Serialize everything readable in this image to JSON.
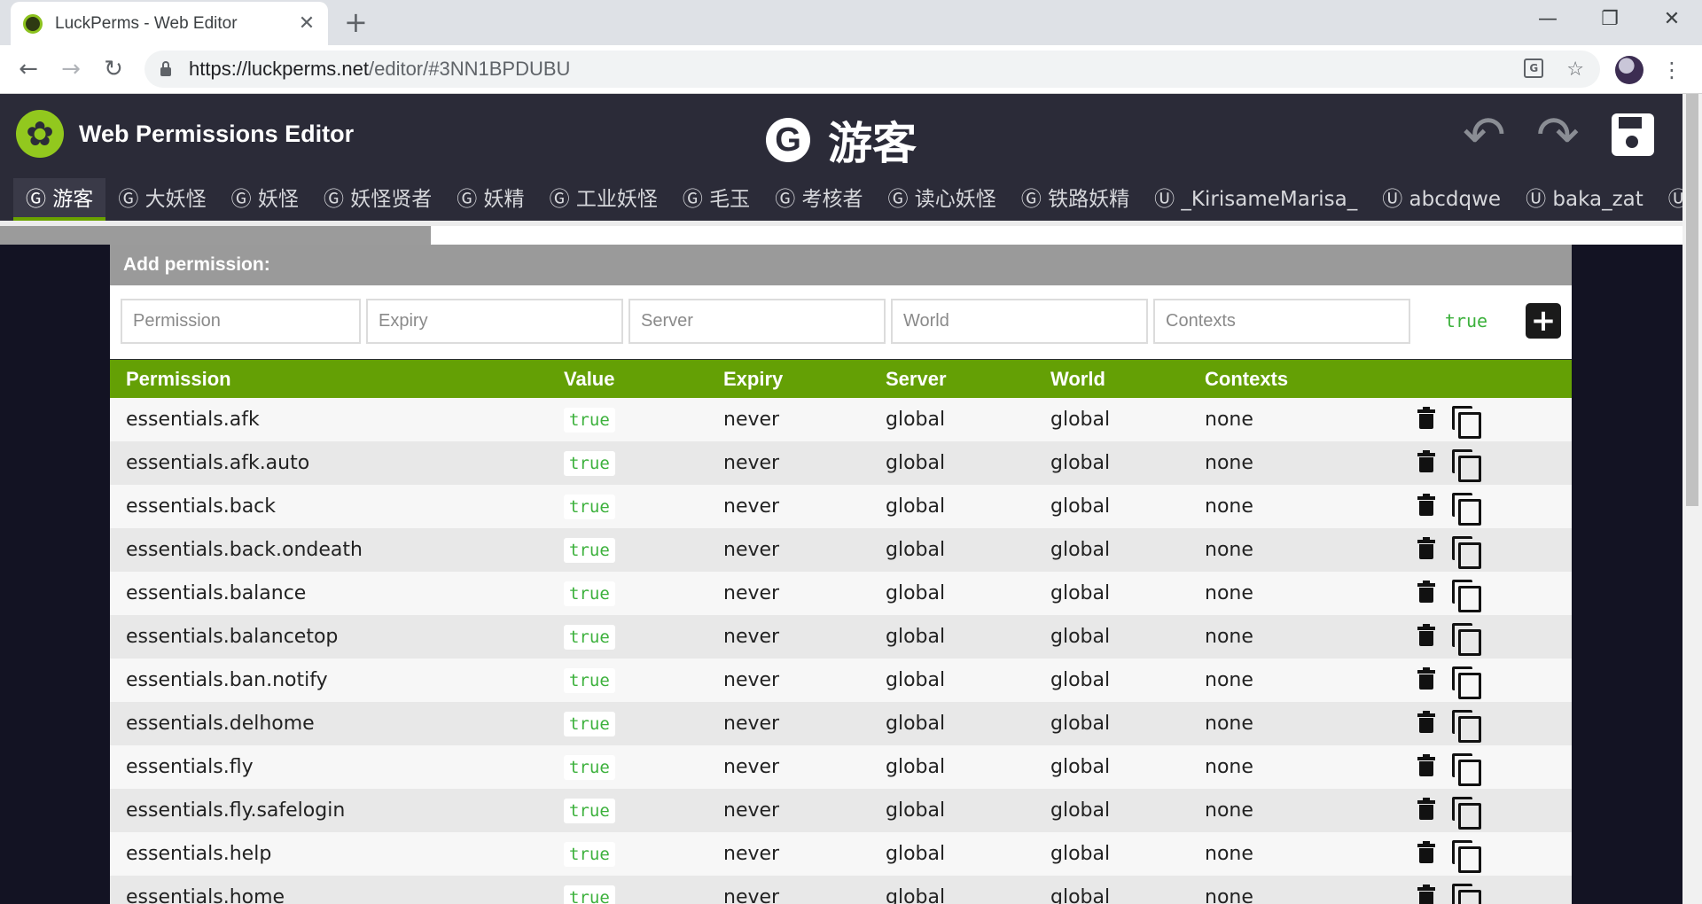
{
  "browser": {
    "tab_title": "LuckPerms - Web Editor",
    "tab_close": "✕",
    "new_tab": "+",
    "url_host": "https://luckperms.net",
    "url_path": "/editor/#3NN1BPDUBU",
    "window_controls": {
      "minimize": "—",
      "restore": "❐",
      "close": "✕"
    }
  },
  "header": {
    "app_title": "Web Permissions Editor",
    "group_badge": "G",
    "group_name": "游客",
    "undo_icon": "undo-icon",
    "redo_icon": "redo-icon",
    "save_icon": "save-icon"
  },
  "holder_tabs": [
    {
      "label": "Ⓖ 游客",
      "active": true
    },
    {
      "label": "Ⓖ 大妖怪"
    },
    {
      "label": "Ⓖ 妖怪"
    },
    {
      "label": "Ⓖ 妖怪贤者"
    },
    {
      "label": "Ⓖ 妖精"
    },
    {
      "label": "Ⓖ 工业妖怪"
    },
    {
      "label": "Ⓖ 毛玉"
    },
    {
      "label": "Ⓖ 考核者"
    },
    {
      "label": "Ⓖ 读心妖怪"
    },
    {
      "label": "Ⓖ 铁路妖精"
    },
    {
      "label": "Ⓤ _KirisameMarisa_"
    },
    {
      "label": "Ⓤ abcdqwe"
    },
    {
      "label": "Ⓤ baka_zat"
    },
    {
      "label": "Ⓤ"
    }
  ],
  "add_permission": {
    "title": "Add permission:",
    "placeholders": {
      "permission": "Permission",
      "expiry": "Expiry",
      "server": "Server",
      "world": "World",
      "contexts": "Contexts"
    },
    "value": "true",
    "add_button": "+"
  },
  "table": {
    "headers": {
      "permission": "Permission",
      "value": "Value",
      "expiry": "Expiry",
      "server": "Server",
      "world": "World",
      "contexts": "Contexts"
    },
    "rows": [
      {
        "permission": "essentials.afk",
        "value": "true",
        "expiry": "never",
        "server": "global",
        "world": "global",
        "contexts": "none"
      },
      {
        "permission": "essentials.afk.auto",
        "value": "true",
        "expiry": "never",
        "server": "global",
        "world": "global",
        "contexts": "none"
      },
      {
        "permission": "essentials.back",
        "value": "true",
        "expiry": "never",
        "server": "global",
        "world": "global",
        "contexts": "none"
      },
      {
        "permission": "essentials.back.ondeath",
        "value": "true",
        "expiry": "never",
        "server": "global",
        "world": "global",
        "contexts": "none"
      },
      {
        "permission": "essentials.balance",
        "value": "true",
        "expiry": "never",
        "server": "global",
        "world": "global",
        "contexts": "none"
      },
      {
        "permission": "essentials.balancetop",
        "value": "true",
        "expiry": "never",
        "server": "global",
        "world": "global",
        "contexts": "none"
      },
      {
        "permission": "essentials.ban.notify",
        "value": "true",
        "expiry": "never",
        "server": "global",
        "world": "global",
        "contexts": "none"
      },
      {
        "permission": "essentials.delhome",
        "value": "true",
        "expiry": "never",
        "server": "global",
        "world": "global",
        "contexts": "none"
      },
      {
        "permission": "essentials.fly",
        "value": "true",
        "expiry": "never",
        "server": "global",
        "world": "global",
        "contexts": "none"
      },
      {
        "permission": "essentials.fly.safelogin",
        "value": "true",
        "expiry": "never",
        "server": "global",
        "world": "global",
        "contexts": "none"
      },
      {
        "permission": "essentials.help",
        "value": "true",
        "expiry": "never",
        "server": "global",
        "world": "global",
        "contexts": "none"
      },
      {
        "permission": "essentials.home",
        "value": "true",
        "expiry": "never",
        "server": "global",
        "world": "global",
        "contexts": "none"
      }
    ]
  },
  "colors": {
    "accent_green": "#64a005",
    "header_bg": "#2b2b38",
    "value_green": "#3cb13c"
  }
}
